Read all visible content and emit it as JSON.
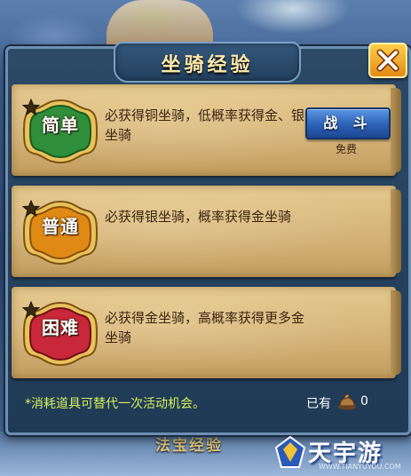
{
  "dialog": {
    "title": "坐骑经验",
    "close_icon": "close-x-icon"
  },
  "levels": [
    {
      "badge": "简单",
      "badge_color": "#2f8f3a",
      "description": "必获得铜坐骑，低概率获得金、银坐骑",
      "action_label": "战 斗",
      "cost_label": "免费"
    },
    {
      "badge": "普通",
      "badge_color": "#e08a16",
      "description": "必获得银坐骑，概率获得金坐骑"
    },
    {
      "badge": "困难",
      "badge_color": "#c9283a",
      "description": "必获得金坐骑，高概率获得更多金坐骑"
    }
  ],
  "footer": {
    "note": "*消耗道具可替代一次活动机会。",
    "owned_label": "已有",
    "owned_icon": "item-pile-icon",
    "owned_count": "0"
  },
  "background": {
    "bottom_text": "法宝经验"
  },
  "watermark": {
    "text": "天宇游",
    "url": "WWW.TIANYUYOU.COM"
  }
}
